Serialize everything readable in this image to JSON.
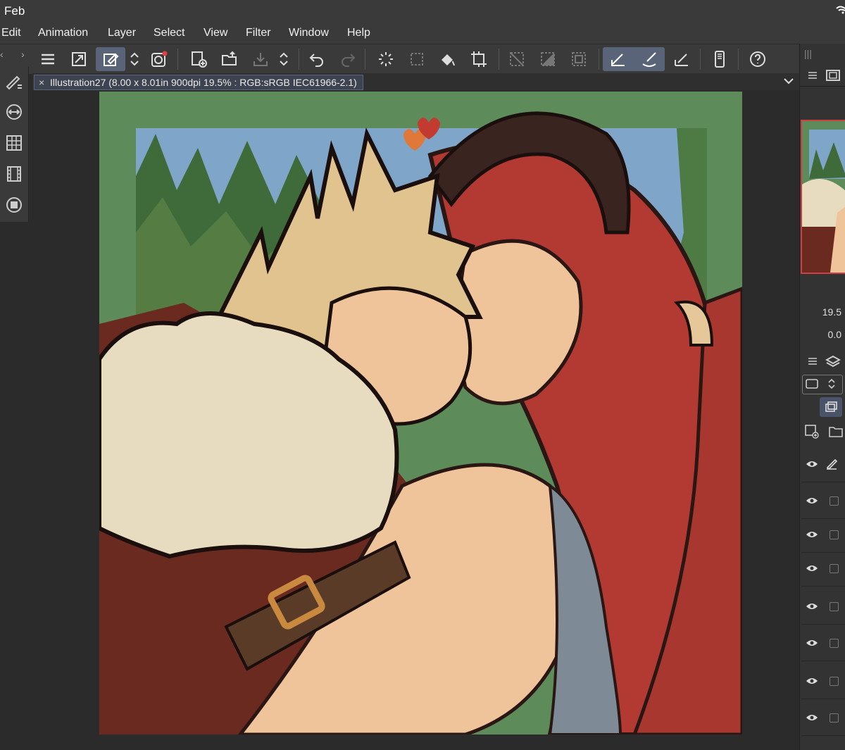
{
  "status": {
    "time": "Feb"
  },
  "menu": [
    "Edit",
    "Animation",
    "Layer",
    "Select",
    "View",
    "Filter",
    "Window",
    "Help"
  ],
  "toolbar": {
    "buttons": [
      "menu-icon",
      "fit-window-icon",
      "brush-mode-icon",
      "scroll-arrows-icon",
      "record-icon",
      "new-canvas-icon",
      "open-folder-icon",
      "save-icon",
      "scroll-arrows-icon",
      "undo-icon",
      "redo-icon",
      "loading-icon",
      "select-transform-icon",
      "fill-icon",
      "crop-icon",
      "deselect-icon",
      "invert-selection-icon",
      "selection-border-icon",
      "pen-tool-icon",
      "brush-tool-icon",
      "ruler-icon",
      "phone-icon",
      "help-icon"
    ]
  },
  "canvas_tab": {
    "title": "Illustration27 (8.00 x 8.01in 900dpi 19.5% : RGB:sRGB IEC61966-2.1)",
    "close": "×"
  },
  "navigator": {
    "zoom": "19.5",
    "rotation": "0.0"
  },
  "layers": {
    "count": 8
  },
  "colors": {
    "panel": "#3a3a3a",
    "canvas_bg": "#2b2b2b",
    "accent": "#5a6478",
    "art_green": "#5d8b5a",
    "art_red": "#b23a32",
    "art_skin": "#f0c49a",
    "art_hair_blond": "#e0c38e",
    "art_fur": "#e8dcc0"
  }
}
